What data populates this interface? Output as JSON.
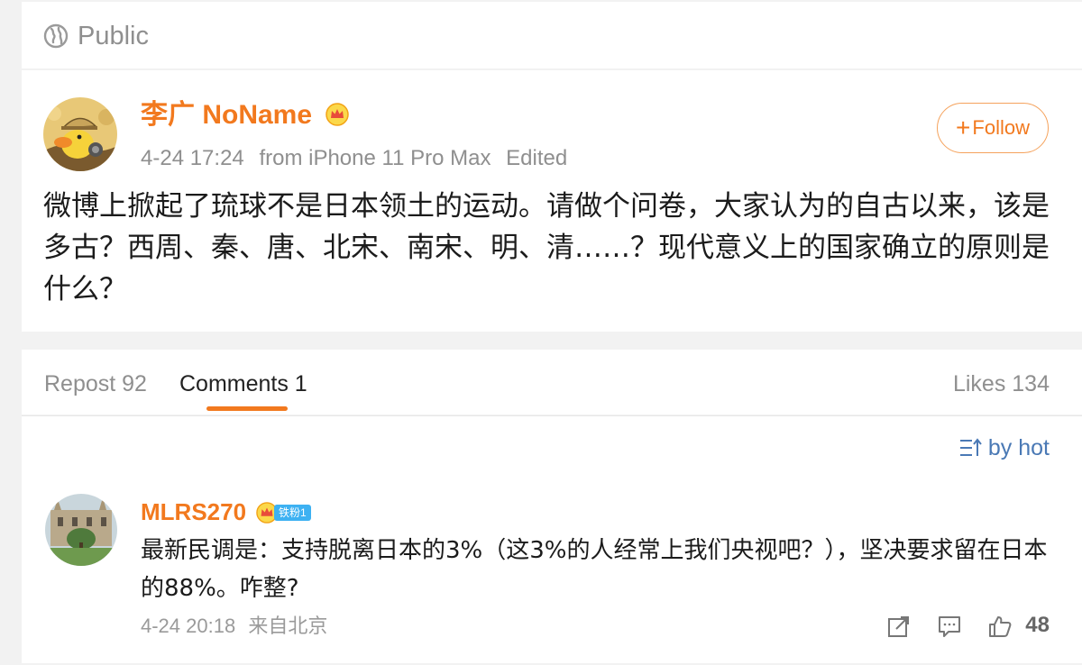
{
  "header": {
    "visibility_label": "Public"
  },
  "post": {
    "author": {
      "name": "李广 NoName"
    },
    "time": "4-24 17:24",
    "source": "from iPhone 11 Pro Max",
    "edited_label": "Edited",
    "follow_button": {
      "plus": "+",
      "label": "Follow"
    },
    "body": "微博上掀起了琉球不是日本领土的运动。请做个问卷，大家认为的自古以来，该是多古？西周、秦、唐、北宋、南宋、明、清……？现代意义上的国家确立的原则是什么？"
  },
  "tabs": [
    {
      "label": "Repost 92"
    },
    {
      "label": "Comments 1"
    },
    {
      "label": "Likes 134"
    }
  ],
  "comments_section": {
    "sort_label": "by hot",
    "items": [
      {
        "name": "MLRS270",
        "badge": "铁粉1",
        "body": "最新民调是：支持脱离日本的3%（这3%的人经常上我们央视吧？），坚决要求留在日本的88%。咋整?",
        "time": "4-24 20:18",
        "location": "来自北京",
        "like_count": "48"
      }
    ]
  },
  "colors": {
    "accent_orange": "#f2791e",
    "link_blue": "#4a79b5",
    "muted_gray": "#8f8f8f",
    "badge_blue": "#3db1f2"
  },
  "icons": {
    "visibility": "globe-icon",
    "vip": "crown-icon",
    "sort": "sort-icon",
    "repost": "share-icon",
    "comment": "comment-icon",
    "like": "thumbs-up-icon"
  }
}
